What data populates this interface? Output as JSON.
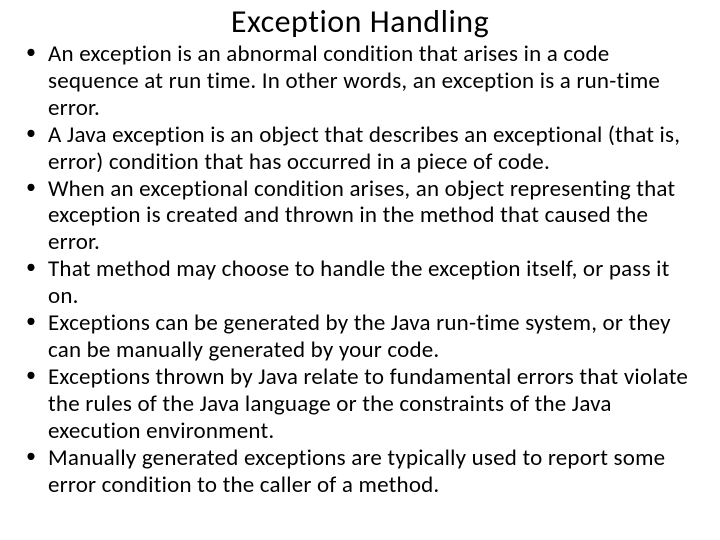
{
  "slide": {
    "title": "Exception Handling",
    "bullets": [
      "An exception is an abnormal condition that arises in a code sequence at run time. In other words, an exception is a run-time error.",
      "A Java exception is an object that describes an exceptional (that is, error) condition that has occurred in a piece of code.",
      "When an exceptional condition arises, an object representing that exception is created and thrown in the method that caused the error.",
      "That method may choose to handle the exception itself, or pass it on.",
      "Exceptions can be generated by the Java run-time system, or they can be manually generated by your code.",
      "Exceptions thrown by Java relate to fundamental errors that violate the rules of the Java language or the constraints of the Java execution environment.",
      "Manually generated exceptions are typically used to report some error condition to the caller of a method."
    ]
  }
}
